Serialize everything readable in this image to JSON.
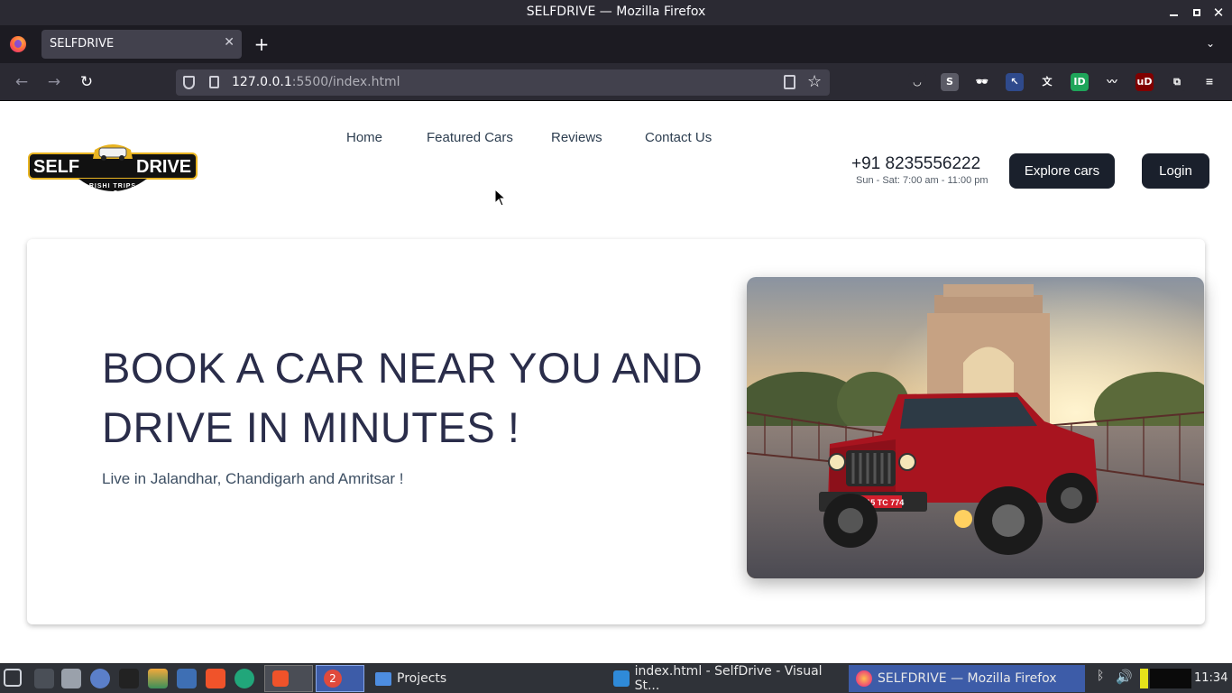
{
  "window": {
    "title": "SELFDRIVE — Mozilla Firefox"
  },
  "browser": {
    "tab_title": "SELFDRIVE",
    "tab_close": "✕",
    "new_tab": "+",
    "url_host": "127.0.0.1",
    "url_rest": ":5500/index.html"
  },
  "extensions": [
    {
      "name": "pocket-icon",
      "color": "#2b2a33",
      "glyph": "◡"
    },
    {
      "name": "s-extension-icon",
      "color": "#5b5b66",
      "glyph": "S"
    },
    {
      "name": "incognito-extension-icon",
      "color": "#2b2a33",
      "glyph": "🕶"
    },
    {
      "name": "cursor-extension-icon",
      "color": "#2f4a8c",
      "glyph": "↖"
    },
    {
      "name": "translate-extension-icon",
      "color": "#2b2a33",
      "glyph": "文"
    },
    {
      "name": "green-extension-icon",
      "color": "#1fa55a",
      "glyph": "ID"
    },
    {
      "name": "pen-extension-icon",
      "color": "#2b2a33",
      "glyph": "〰"
    },
    {
      "name": "ublock-icon",
      "color": "#800000",
      "glyph": "uD"
    },
    {
      "name": "extensions-puzzle-icon",
      "color": "#2b2a33",
      "glyph": "⧉"
    },
    {
      "name": "hamburger-menu-icon",
      "color": "#2b2a33",
      "glyph": "≡"
    }
  ],
  "site": {
    "logo": {
      "text_left": "SELF",
      "text_right": "DRIVE",
      "tagline": "RISHI TRIPS",
      "bg_color": "#e8b422"
    },
    "nav": {
      "home": "Home",
      "featured": "Featured Cars",
      "reviews": "Reviews",
      "contact": "Contact Us"
    },
    "phone": "+91 8235556222",
    "hours": "Sun - Sat: 7:00 am - 11:00 pm",
    "explore_label": "Explore cars",
    "login_label": "Login"
  },
  "hero": {
    "headline": "BOOK A CAR NEAR YOU AND DRIVE IN MINUTES !",
    "subtitle": "Live in Jalandhar, Chandigarh and Amritsar !",
    "image_alt": "Red Mahindra Thar in front of India Gate",
    "plate": "MH 15 TC 774"
  },
  "taskbar": {
    "projects": "Projects",
    "vscode": "index.html - SelfDrive - Visual St...",
    "firefox": "SELFDRIVE — Mozilla Firefox",
    "badge": "2",
    "clock": "11:34"
  }
}
